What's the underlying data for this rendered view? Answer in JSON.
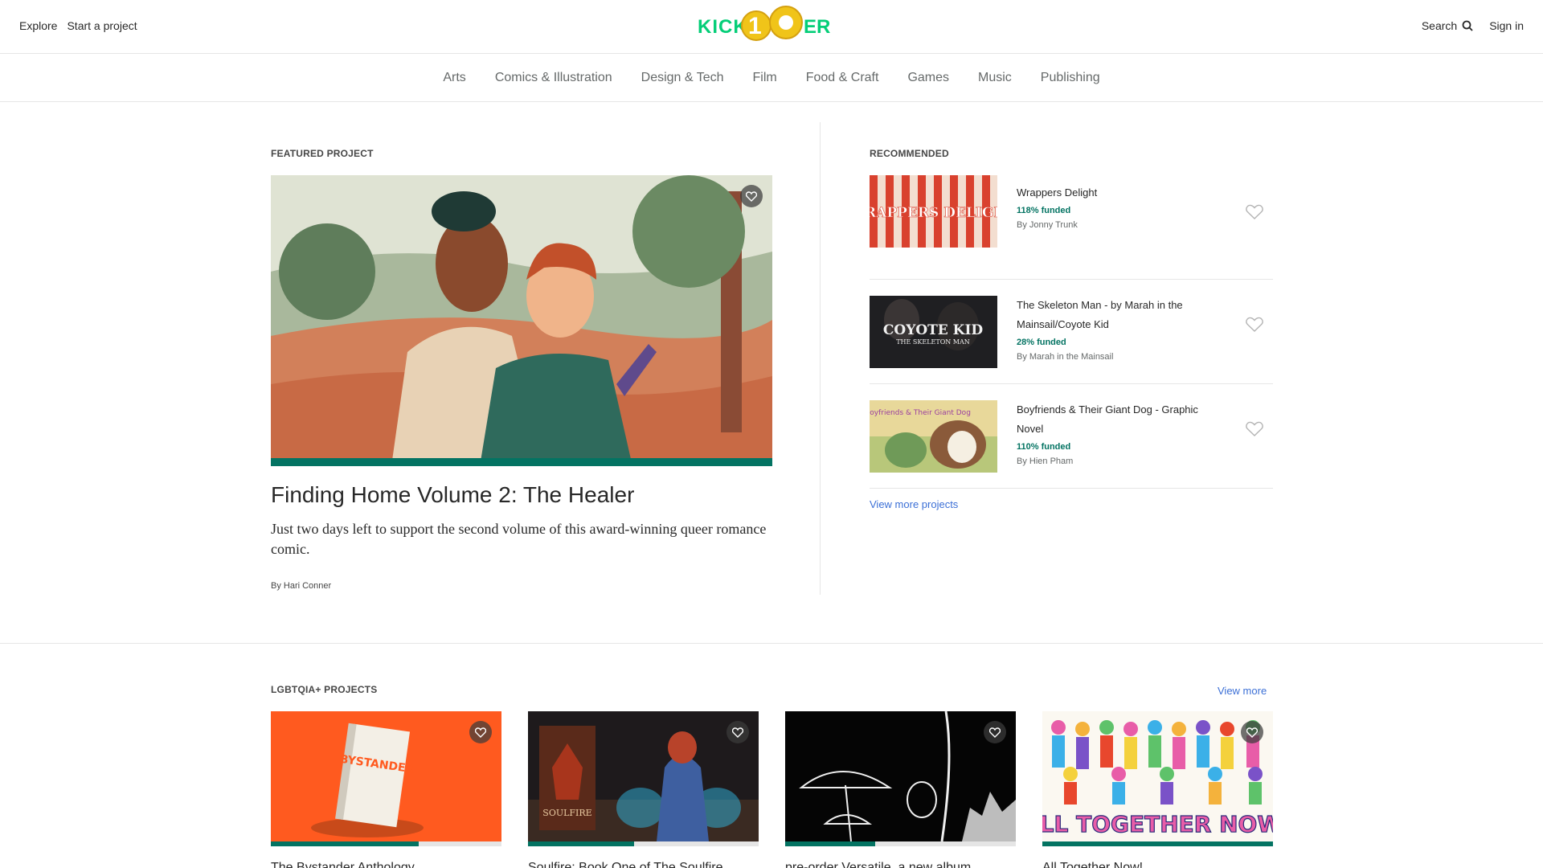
{
  "header": {
    "explore": "Explore",
    "start_project": "Start a project",
    "search": "Search",
    "sign_in": "Sign in",
    "logo_text": "KICKSTARTER",
    "logo_color": "#05ce78"
  },
  "categories": [
    "Arts",
    "Comics & Illustration",
    "Design & Tech",
    "Film",
    "Food & Craft",
    "Games",
    "Music",
    "Publishing"
  ],
  "featured": {
    "label": "FEATURED PROJECT",
    "title": "Finding Home Volume 2: The Healer",
    "blurb": "Just two days left to support the second volume of this award-winning queer romance comic.",
    "by": "By Hari Conner",
    "progress": 1.0
  },
  "recommended": {
    "label": "RECOMMENDED",
    "items": [
      {
        "title": "Wrappers Delight",
        "funded": "118% funded",
        "by": "By Jonny Trunk",
        "thumb_text": "WRAPPERS DELIGHT"
      },
      {
        "title": "The Skeleton Man - by Marah in the Mainsail/Coyote Kid",
        "funded": "28% funded",
        "by": "By Marah in the Mainsail",
        "thumb_text": "COYOTE KID",
        "thumb_subtext": "THE SKELETON MAN"
      },
      {
        "title": "Boyfriends & Their Giant Dog - Graphic Novel",
        "funded": "110% funded",
        "by": "By Hien Pham",
        "thumb_text": "Boyfriends & Their Giant Dog"
      }
    ],
    "view_more": "View more projects"
  },
  "lgbtqia": {
    "label": "LGBTQIA+ PROJECTS",
    "view_more": "View more",
    "cards": [
      {
        "title": "The Bystander Anthology",
        "progress": 0.64,
        "cover_text": "BYSTANDER"
      },
      {
        "title": "Soulfire: Book One of The Soulfire",
        "progress": 0.46,
        "cover_text": "SOULFIRE"
      },
      {
        "title": "pre-order Versatile, a new album",
        "progress": 0.39
      },
      {
        "title": "All Together Now!",
        "progress": 1.0,
        "cover_text": "ALL TOGETHER NOW!"
      }
    ]
  },
  "colors": {
    "accent_green": "#037362",
    "link_blue": "#3b6fd6"
  }
}
